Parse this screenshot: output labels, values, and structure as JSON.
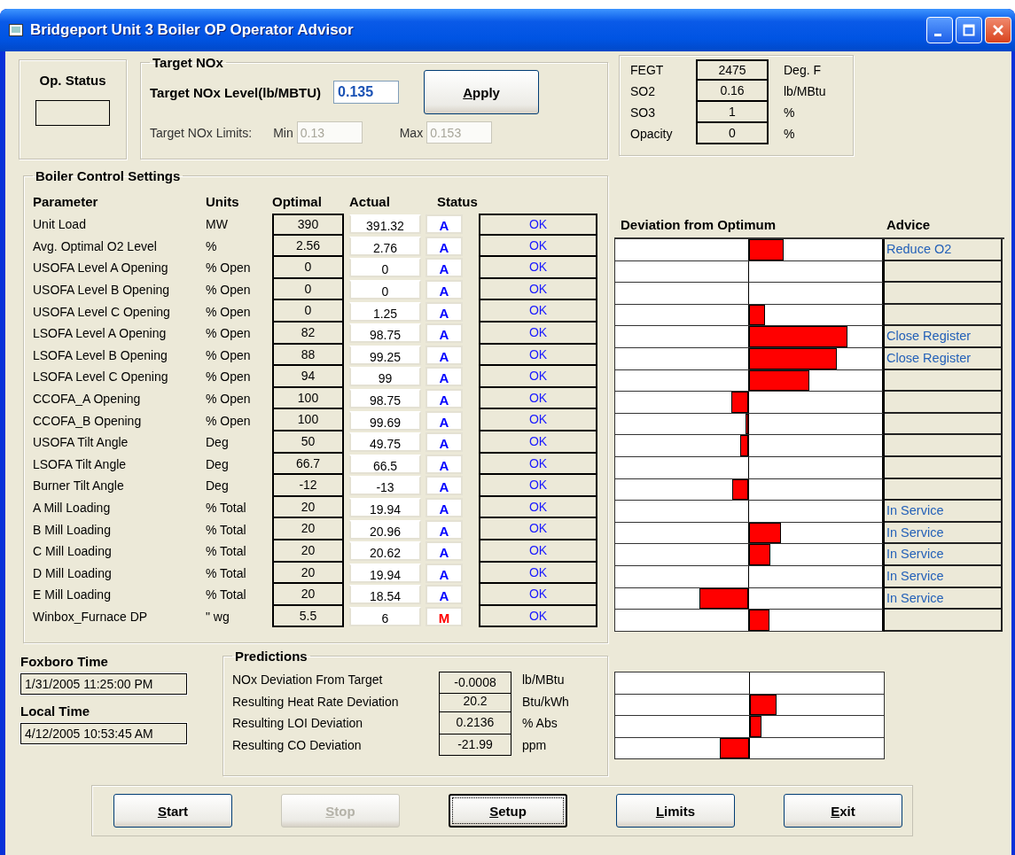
{
  "window": {
    "title": "Bridgeport Unit 3 Boiler OP Operator Advisor"
  },
  "op_status": {
    "title": "Op. Status"
  },
  "target_nox": {
    "title": "Target NOx",
    "level_label": "Target NOx Level(lb/MBTU)",
    "level_value": "0.135",
    "apply_button": "Apply",
    "limits_label": "Target NOx Limits:",
    "min": {
      "label": "Min",
      "value": "0.13",
      "disabled": true
    },
    "max": {
      "label": "Max",
      "value": "0.153",
      "disabled": true
    }
  },
  "readings": [
    {
      "name": "FEGT",
      "value": "2475",
      "unit": "Deg. F"
    },
    {
      "name": "SO2",
      "value": "0.16",
      "unit": "lb/MBtu"
    },
    {
      "name": "SO3",
      "value": "1",
      "unit": "%"
    },
    {
      "name": "Opacity",
      "value": "0",
      "unit": "%"
    }
  ],
  "boiler_control_settings": {
    "title": "Boiler Control Settings",
    "columns": [
      "Parameter",
      "Units",
      "Optimal",
      "Actual",
      "Status"
    ],
    "rows": [
      {
        "parameter": "Unit Load",
        "units": "MW",
        "optimal": "390",
        "actual": "391.32",
        "mode": {
          "text": "A",
          "color": "#0000ff"
        },
        "status": "OK"
      },
      {
        "parameter": "Avg. Optimal O2 Level",
        "units": "%",
        "optimal": "2.56",
        "actual": "2.76",
        "mode": {
          "text": "A",
          "color": "#0000ff"
        },
        "status": "OK"
      },
      {
        "parameter": "USOFA Level A Opening",
        "units": "% Open",
        "optimal": "0",
        "actual": "0",
        "mode": {
          "text": "A",
          "color": "#0000ff"
        },
        "status": "OK"
      },
      {
        "parameter": "USOFA Level B Opening",
        "units": "% Open",
        "optimal": "0",
        "actual": "0",
        "mode": {
          "text": "A",
          "color": "#0000ff"
        },
        "status": "OK"
      },
      {
        "parameter": "USOFA Level C Opening",
        "units": "% Open",
        "optimal": "0",
        "actual": "1.25",
        "mode": {
          "text": "A",
          "color": "#0000ff"
        },
        "status": "OK"
      },
      {
        "parameter": "LSOFA Level A Opening",
        "units": "% Open",
        "optimal": "82",
        "actual": "98.75",
        "mode": {
          "text": "A",
          "color": "#0000ff"
        },
        "status": "OK"
      },
      {
        "parameter": "LSOFA Level B Opening",
        "units": "% Open",
        "optimal": "88",
        "actual": "99.25",
        "mode": {
          "text": "A",
          "color": "#0000ff"
        },
        "status": "OK"
      },
      {
        "parameter": "LSOFA Level C Opening",
        "units": "% Open",
        "optimal": "94",
        "actual": "99",
        "mode": {
          "text": "A",
          "color": "#0000ff"
        },
        "status": "OK"
      },
      {
        "parameter": "CCOFA_A Opening",
        "units": "% Open",
        "optimal": "100",
        "actual": "98.75",
        "mode": {
          "text": "A",
          "color": "#0000ff"
        },
        "status": "OK"
      },
      {
        "parameter": "CCOFA_B Opening",
        "units": "% Open",
        "optimal": "100",
        "actual": "99.69",
        "mode": {
          "text": "A",
          "color": "#0000ff"
        },
        "status": "OK"
      },
      {
        "parameter": "USOFA Tilt Angle",
        "units": "Deg",
        "optimal": "50",
        "actual": "49.75",
        "mode": {
          "text": "A",
          "color": "#0000ff"
        },
        "status": "OK"
      },
      {
        "parameter": "LSOFA Tilt Angle",
        "units": "Deg",
        "optimal": "66.7",
        "actual": "66.5",
        "mode": {
          "text": "A",
          "color": "#0000ff"
        },
        "status": "OK"
      },
      {
        "parameter": "Burner Tilt Angle",
        "units": "Deg",
        "optimal": "-12",
        "actual": "-13",
        "mode": {
          "text": "A",
          "color": "#0000ff"
        },
        "status": "OK"
      },
      {
        "parameter": "A Mill Loading",
        "units": "% Total",
        "optimal": "20",
        "actual": "19.94",
        "mode": {
          "text": "A",
          "color": "#0000ff"
        },
        "status": "OK"
      },
      {
        "parameter": "B Mill Loading",
        "units": "% Total",
        "optimal": "20",
        "actual": "20.96",
        "mode": {
          "text": "A",
          "color": "#0000ff"
        },
        "status": "OK"
      },
      {
        "parameter": "C Mill Loading",
        "units": "% Total",
        "optimal": "20",
        "actual": "20.62",
        "mode": {
          "text": "A",
          "color": "#0000ff"
        },
        "status": "OK"
      },
      {
        "parameter": "D Mill Loading",
        "units": "% Total",
        "optimal": "20",
        "actual": "19.94",
        "mode": {
          "text": "A",
          "color": "#0000ff"
        },
        "status": "OK"
      },
      {
        "parameter": "E Mill Loading",
        "units": "% Total",
        "optimal": "20",
        "actual": "18.54",
        "mode": {
          "text": "A",
          "color": "#0000ff"
        },
        "status": "OK"
      },
      {
        "parameter": "Winbox_Furnace DP",
        "units": "\" wg",
        "optimal": "5.5",
        "actual": "6",
        "mode": {
          "text": "M",
          "color": "#ff0000"
        },
        "status": "OK"
      }
    ]
  },
  "deviation": {
    "title": "Deviation from Optimum",
    "advice_title": "Advice",
    "rows": [
      {
        "right": {
          "level": 0.26
        },
        "advice": "Reduce O2"
      },
      {},
      {},
      {
        "right": {
          "level": 0.12
        }
      },
      {
        "right": {
          "level": 0.74
        },
        "advice": "Close Register"
      },
      {
        "right": {
          "level": 0.66
        },
        "advice": "Close Register"
      },
      {
        "right": {
          "level": 0.45
        }
      },
      {
        "left": {
          "level": 0.125
        }
      },
      {
        "left": {
          "level": 0.02
        }
      },
      {
        "left": {
          "level": 0.06
        }
      },
      {},
      {
        "left": {
          "level": 0.12
        }
      },
      {
        "advice": "In Service"
      },
      {
        "right": {
          "level": 0.24
        },
        "advice": "In Service"
      },
      {
        "right": {
          "level": 0.16
        },
        "advice": "In Service"
      },
      {
        "advice": "In Service"
      },
      {
        "left": {
          "level": 0.37
        },
        "advice": "In Service"
      },
      {
        "right": {
          "level": 0.15
        }
      }
    ]
  },
  "times": [
    {
      "label": "Foxboro Time",
      "value": "1/31/2005 11:25:00 PM"
    },
    {
      "label": "Local Time",
      "value": "4/12/2005 10:53:45 AM"
    }
  ],
  "predictions": {
    "title": "Predictions",
    "rows": [
      {
        "label": "NOx Deviation From Target",
        "value": "-0.0008",
        "unit": "lb/MBtu"
      },
      {
        "label": "Resulting Heat Rate Deviation",
        "value": "20.2",
        "unit": "Btu/kWh",
        "right": {
          "level": 0.2
        }
      },
      {
        "label": "Resulting LOI Deviation",
        "value": "0.2136",
        "unit": "% Abs",
        "right": {
          "level": 0.085
        }
      },
      {
        "label": "Resulting CO Deviation",
        "value": "-21.99",
        "unit": "ppm",
        "left": {
          "level": 0.22
        }
      }
    ]
  },
  "buttons": [
    {
      "label": "Start",
      "disabled": false,
      "focused": false
    },
    {
      "label": "Stop",
      "disabled": true,
      "focused": false
    },
    {
      "label": "Setup",
      "disabled": false,
      "focused": true
    },
    {
      "label": "Limits",
      "disabled": false,
      "focused": false
    },
    {
      "label": "Exit",
      "disabled": false,
      "focused": false
    }
  ]
}
